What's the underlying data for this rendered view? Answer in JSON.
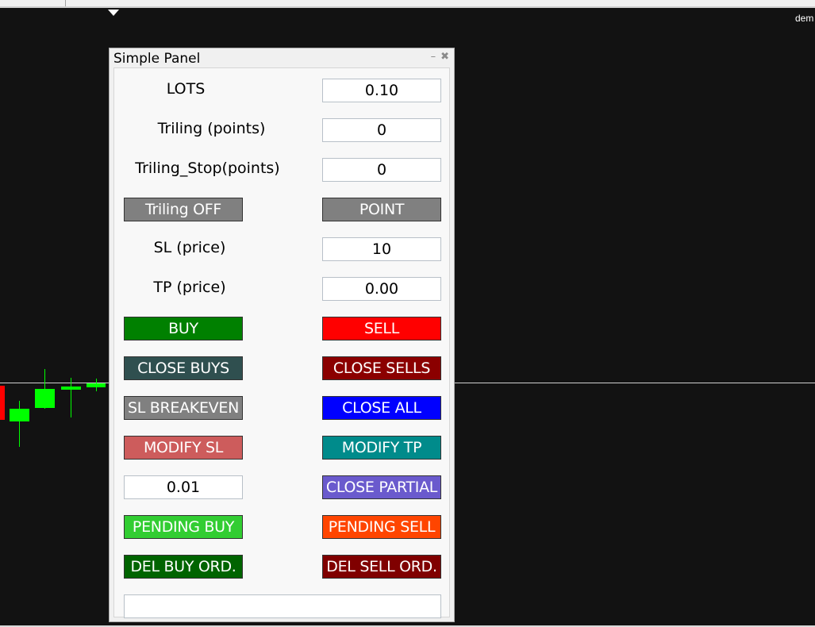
{
  "chart": {
    "corner_label": "dem",
    "candles": [
      {
        "type": "down"
      },
      {
        "type": "up"
      },
      {
        "type": "up"
      },
      {
        "type": "up"
      },
      {
        "type": "up"
      }
    ]
  },
  "panel": {
    "title": "Simple Panel",
    "minimize_icon": "minimize-icon",
    "close_icon": "close-icon",
    "lots_label": "LOTS",
    "lots_value": "0.10",
    "trailing_label": "Triling (points)",
    "trailing_value": "0",
    "trailing_stop_label": "Triling_Stop(points)",
    "trailing_stop_value": "0",
    "trailing_toggle": "Triling OFF",
    "point_button": "POINT",
    "sl_label": "SL (price)",
    "sl_value": "10",
    "tp_label": "TP (price)",
    "tp_value": "0.00",
    "buy": "BUY",
    "sell": "SELL",
    "close_buys": "CLOSE BUYS",
    "close_sells": "CLOSE SELLS",
    "sl_breakeven": "SL BREAKEVEN",
    "close_all": "CLOSE ALL",
    "modify_sl": "MODIFY SL",
    "modify_tp": "MODIFY TP",
    "partial_value": "0.01",
    "close_partial": "CLOSE PARTIAL",
    "pending_buy": "PENDING BUY",
    "pending_sell": "PENDING SELL",
    "del_buy_ord": "DEL BUY ORD.",
    "del_sell_ord": "DEL SELL ORD.",
    "status_text": ""
  },
  "colors": {
    "buy": "#008000",
    "sell": "#ff0000",
    "close_buys": "#2f4f4f",
    "close_sells": "#8b0000",
    "sl_breakeven": "#808080",
    "close_all": "#0000ff",
    "modify_sl": "#cd5c5c",
    "modify_tp": "#008b8b",
    "close_partial": "#6a5acd",
    "pending_buy": "#32cd32",
    "pending_sell": "#ff4500",
    "del_buy_ord": "#006400",
    "del_sell_ord": "#800000",
    "toggle_gray": "#808080"
  }
}
